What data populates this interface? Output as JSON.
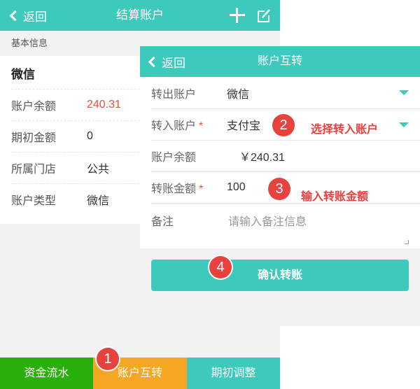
{
  "background": {
    "header": {
      "back_label": "返回",
      "title": "结算账户"
    },
    "section_title": "基本信息",
    "account_name": "微信",
    "rows": [
      {
        "label": "账户余额",
        "value": "240.31"
      },
      {
        "label": "期初金额",
        "value": "0"
      },
      {
        "label": "所属门店",
        "value": "公共"
      },
      {
        "label": "账户类型",
        "value": "微信"
      }
    ],
    "tabs": [
      {
        "label": "资金流水"
      },
      {
        "label": "账户互转"
      },
      {
        "label": "期初调整"
      }
    ]
  },
  "panel": {
    "header": {
      "back_label": "返回",
      "title": "账户互转"
    },
    "fields": {
      "from_account": {
        "label": "转出账户",
        "value": "微信"
      },
      "to_account": {
        "label": "转入账户",
        "required": "*",
        "value": "支付宝"
      },
      "balance": {
        "label": "账户余额",
        "value": "￥240.31"
      },
      "amount": {
        "label": "转账金额",
        "required": "*",
        "value": "100"
      },
      "remark": {
        "label": "备注",
        "placeholder": "请输入备注信息"
      }
    },
    "confirm_label": "确认转账"
  },
  "annotations": [
    {
      "number": "1"
    },
    {
      "number": "2",
      "text": "选择转入账户"
    },
    {
      "number": "3",
      "text": "输入转账金额"
    },
    {
      "number": "4"
    }
  ],
  "colors": {
    "teal": "#3ec9bd",
    "green": "#2ab00a",
    "orange": "#f5a623",
    "red": "#e8423f"
  },
  "icons": [
    "back-chevron-icon",
    "plus-icon",
    "edit-icon",
    "dropdown-caret-icon"
  ]
}
